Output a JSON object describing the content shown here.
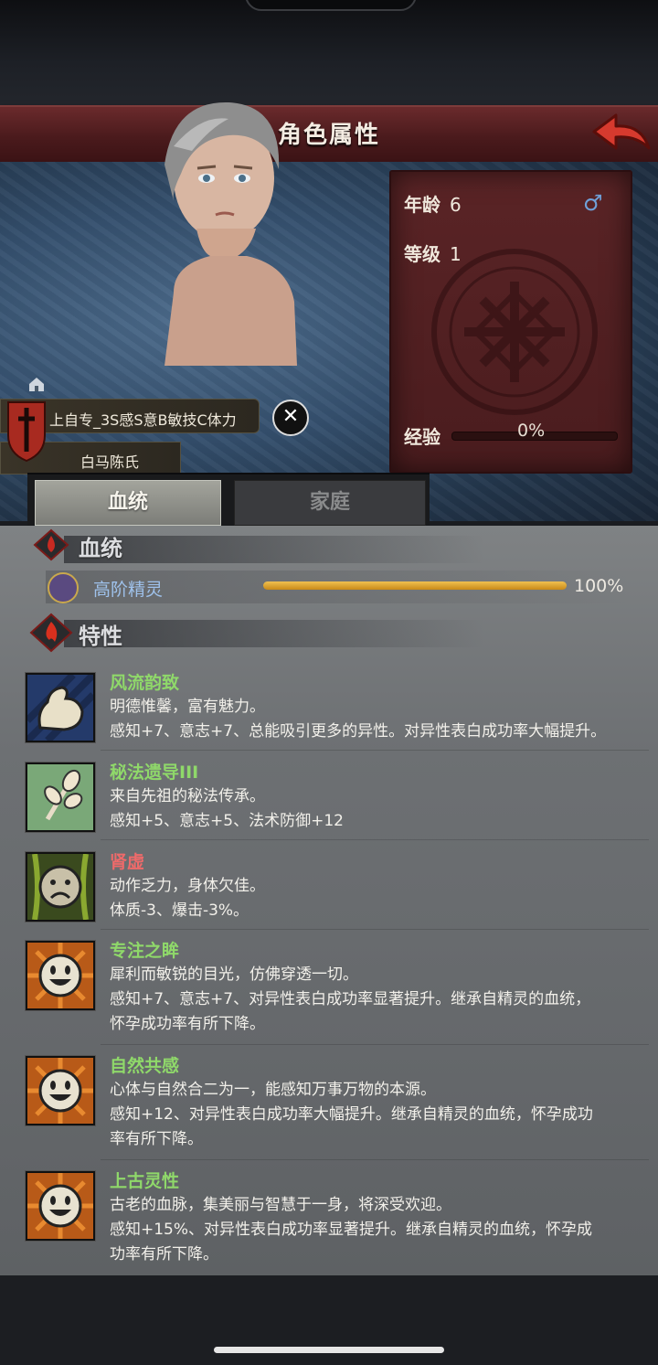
{
  "header": {
    "title": "角色属性",
    "back_icon": "back-arrow-icon"
  },
  "character": {
    "age_label": "年龄",
    "age": "6",
    "gender_symbol": "♂",
    "level_label": "等级",
    "level": "1",
    "exp_label": "经验",
    "exp_pct": "0%",
    "exp_progress": 0,
    "name": "上自专_3S感S意B敏技C体力",
    "clan": "白马陈氏",
    "close_symbol": "✕"
  },
  "tabs": [
    {
      "label": "血统",
      "active": true
    },
    {
      "label": "家庭",
      "active": false
    }
  ],
  "bloodline_section": {
    "title": "血统",
    "entry": {
      "name": "高阶精灵",
      "pct": "100%",
      "progress": 1.0
    }
  },
  "traits_section": {
    "title": "特性",
    "traits": [
      {
        "name": "风流韵致",
        "color": "green",
        "icon": "flexed-arm-icon",
        "lines": [
          "明德惟馨，富有魅力。",
          "感知+7、意志+7、总能吸引更多的异性。对异性表白成功率大幅提升。"
        ]
      },
      {
        "name": "秘法遗导III",
        "color": "green",
        "icon": "leaf-sprig-icon",
        "lines": [
          "来自先祖的秘法传承。",
          "感知+5、意志+5、法术防御+12"
        ]
      },
      {
        "name": "肾虚",
        "color": "red",
        "icon": "sad-face-icon",
        "lines": [
          "动作乏力，身体欠佳。",
          "体质-3、爆击-3%。"
        ]
      },
      {
        "name": "专注之眸",
        "color": "green",
        "icon": "smiley-sun-icon",
        "lines": [
          "犀利而敏锐的目光，仿佛穿透一切。",
          "感知+7、意志+7、对异性表白成功率显著提升。继承自精灵的血统，",
          "怀孕成功率有所下降。"
        ]
      },
      {
        "name": "自然共感",
        "color": "green",
        "icon": "smiley-sun-icon",
        "lines": [
          "心体与自然合二为一，能感知万事万物的本源。",
          "感知+12、对异性表白成功率大幅提升。继承自精灵的血统，怀孕成功",
          "率有所下降。"
        ]
      },
      {
        "name": "上古灵性",
        "color": "green",
        "icon": "smiley-sun-icon",
        "lines": [
          "古老的血脉，集美丽与智慧于一身，将深受欢迎。",
          "感知+15%、对异性表白成功率显著提升。继承自精灵的血统，怀孕成",
          "功率有所下降。"
        ]
      }
    ]
  }
}
